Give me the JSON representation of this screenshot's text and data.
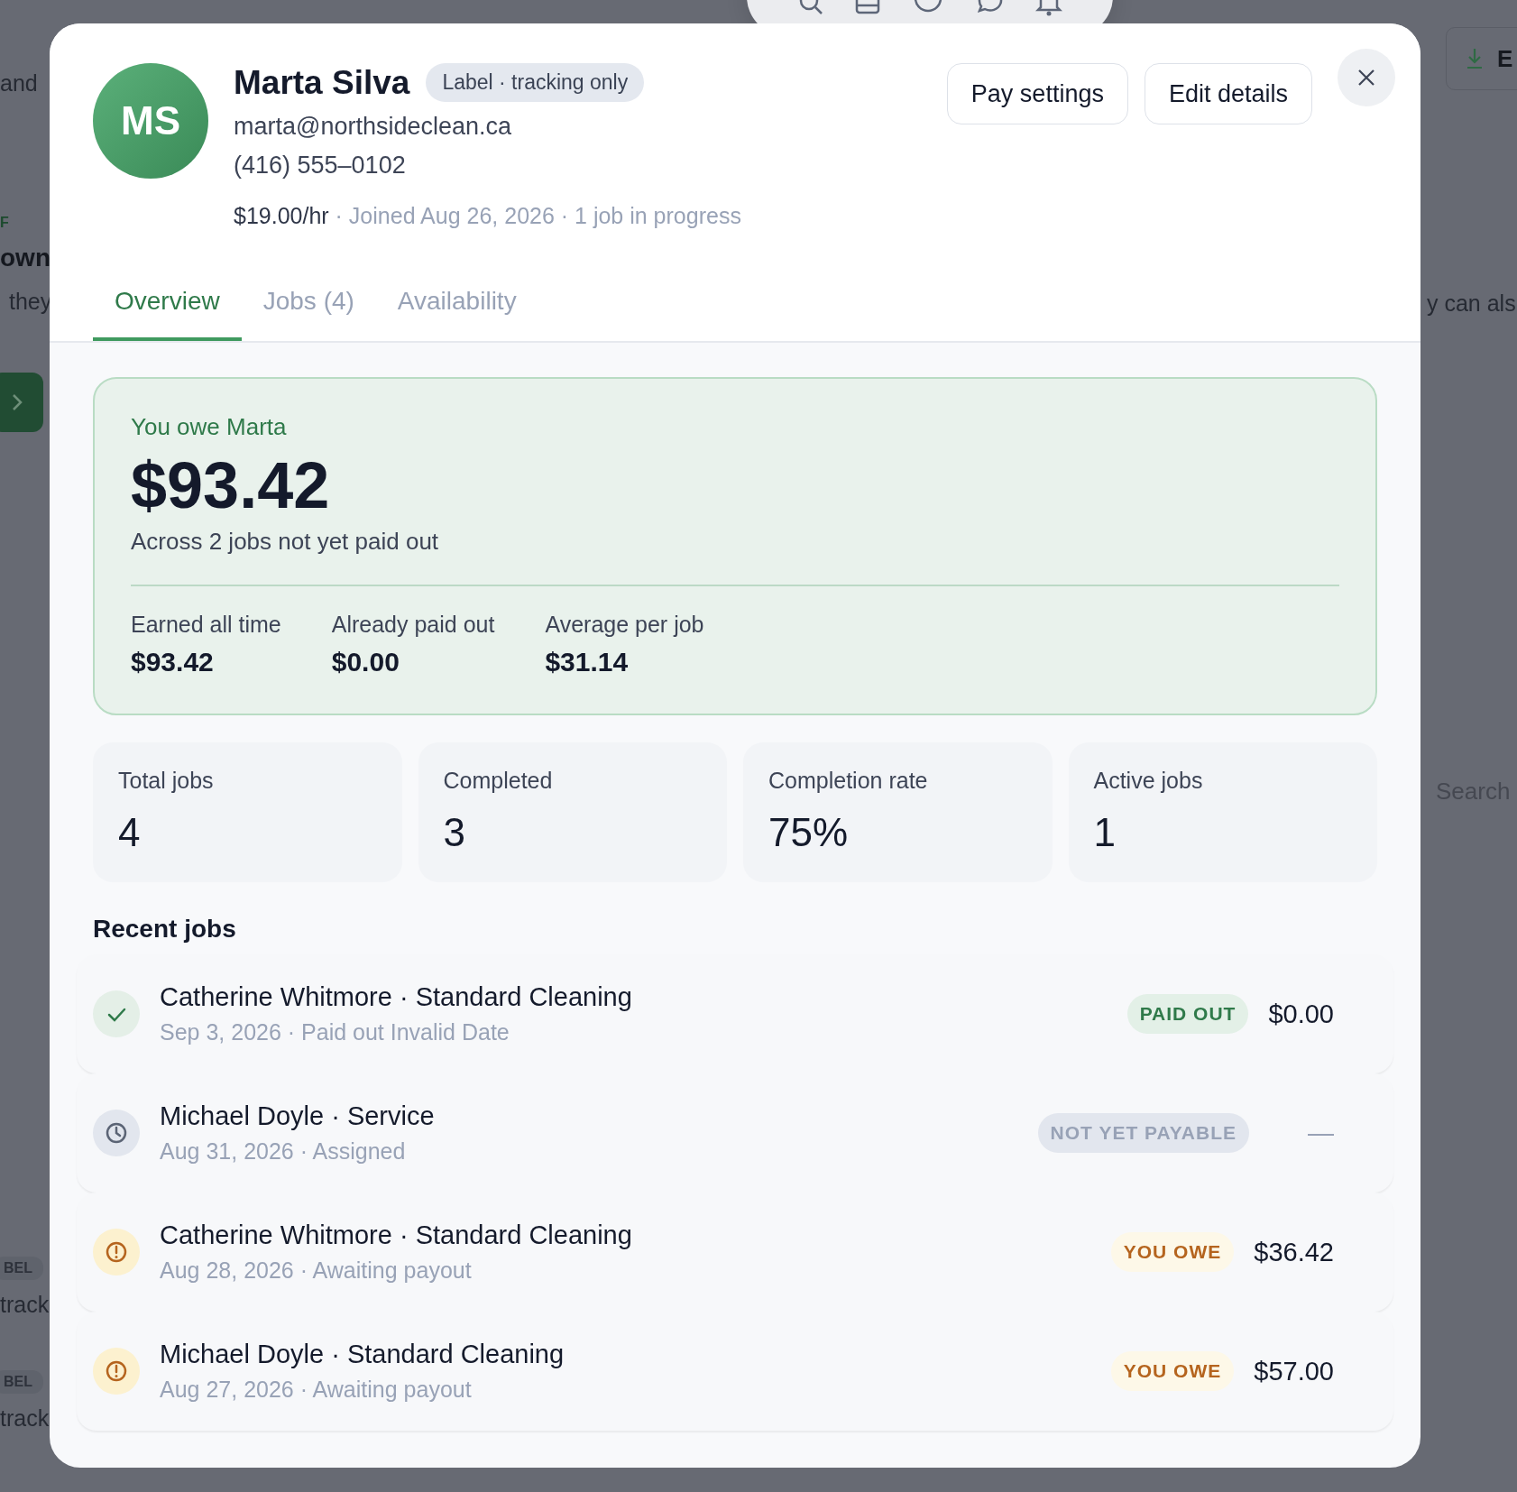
{
  "backdrop": [
    {
      "kind": "text",
      "text": "and"
    },
    {
      "kind": "eyebrow",
      "text": "F"
    },
    {
      "kind": "heading",
      "text": "own"
    },
    {
      "kind": "text",
      "text": "they"
    },
    {
      "kind": "chevron-button"
    },
    {
      "kind": "badge",
      "text": "BEL"
    },
    {
      "kind": "text",
      "text": "track"
    },
    {
      "kind": "badge",
      "text": "BEL"
    },
    {
      "kind": "text",
      "text": "track"
    },
    {
      "kind": "export-button",
      "text": "E"
    },
    {
      "kind": "text",
      "text": "y can als"
    },
    {
      "kind": "search",
      "placeholder": "Search"
    }
  ],
  "profile": {
    "initials": "MS",
    "name": "Marta Silva",
    "tag": "Label · tracking only",
    "email": "marta@northsideclean.ca",
    "phone": "(416) 555‒0102",
    "rate": "$19.00/hr",
    "details": "· Joined Aug 26, 2026 · 1 job in progress"
  },
  "actions": [
    "Pay settings",
    "Edit details"
  ],
  "tabs": [
    {
      "label": "Overview",
      "selected": true
    },
    {
      "label": "Jobs (4)",
      "selected": false
    },
    {
      "label": "Availability",
      "selected": false
    }
  ],
  "balance": {
    "title": "You owe Marta",
    "amount": "$93.42",
    "note": "Across 2 jobs not yet paid out",
    "stats": [
      {
        "label": "Earned all time",
        "value": "$93.42"
      },
      {
        "label": "Already paid out",
        "value": "$0.00"
      },
      {
        "label": "Average per job",
        "value": "$31.14"
      }
    ]
  },
  "metrics": [
    {
      "label": "Total jobs",
      "value": "4"
    },
    {
      "label": "Completed",
      "value": "3"
    },
    {
      "label": "Completion rate",
      "value": "75%"
    },
    {
      "label": "Active jobs",
      "value": "1"
    }
  ],
  "recent_jobs": {
    "title": "Recent jobs",
    "rows": [
      {
        "kind": "paid",
        "title": "Catherine Whitmore · Standard Cleaning",
        "subtitle": "Sep 3, 2026 · Paid out Invalid Date",
        "badge": "PAID OUT",
        "amount": "$0.00"
      },
      {
        "kind": "pending",
        "title": "Michael Doyle · Service",
        "subtitle": "Aug 31, 2026 · Assigned",
        "badge": "NOT YET PAYABLE",
        "amount": "—"
      },
      {
        "kind": "owed",
        "title": "Catherine Whitmore · Standard Cleaning",
        "subtitle": "Aug 28, 2026 · Awaiting payout",
        "badge": "YOU OWE",
        "amount": "$36.42"
      },
      {
        "kind": "owed",
        "title": "Michael Doyle · Standard Cleaning",
        "subtitle": "Aug 27, 2026 · Awaiting payout",
        "badge": "YOU OWE",
        "amount": "$57.00"
      }
    ]
  }
}
